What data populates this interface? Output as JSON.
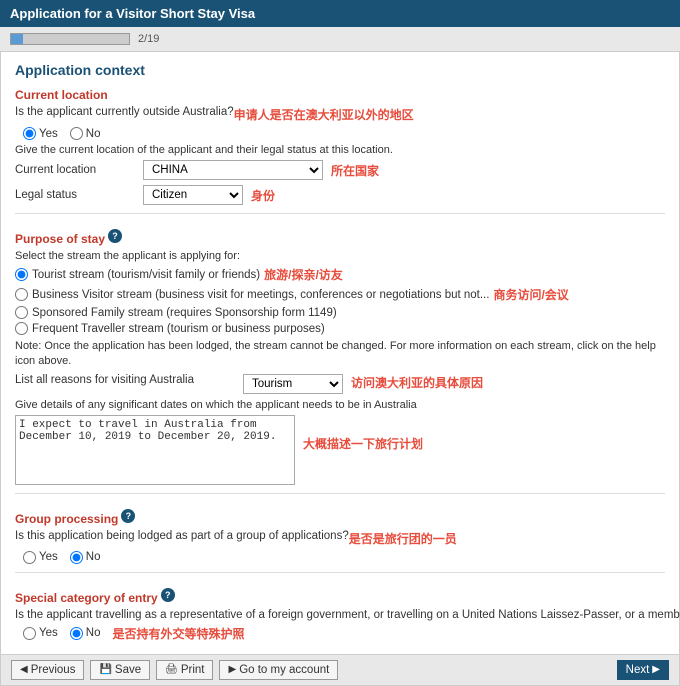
{
  "title_bar": {
    "label": "Application for a Visitor Short Stay Visa"
  },
  "progress": {
    "page_current": 2,
    "page_total": 19,
    "counter": "2/19",
    "bar_percent": 10
  },
  "application_context": {
    "section_title": "Application context",
    "current_location": {
      "subsection": "Current location",
      "question": "Is the applicant currently outside Australia?",
      "annotation": "申请人是否在澳大利亚以外的地区",
      "yes_label": "Yes",
      "no_label": "No",
      "yes_selected": true,
      "description": "Give the current location of the applicant and their legal status at this location.",
      "fields": [
        {
          "label": "Current location",
          "value": "CHINA",
          "annotation": "所在国家",
          "type": "select"
        },
        {
          "label": "Legal status",
          "value": "Citizen",
          "annotation": "身份",
          "type": "select"
        }
      ]
    },
    "purpose_of_stay": {
      "subsection": "Purpose of stay",
      "has_info": true,
      "description": "Select the stream the applicant is applying for:",
      "streams": [
        {
          "id": "tourist",
          "label": "Tourist stream (tourism/visit family or friends)",
          "selected": true,
          "annotation": "旅游/探亲/访友"
        },
        {
          "id": "business",
          "label": "Business Visitor stream (business visit for meetings, conferences or negotiations but not...",
          "selected": false,
          "annotation": "商务访问/会议"
        },
        {
          "id": "sponsored",
          "label": "Sponsored Family stream (requires Sponsorship form 1149)",
          "selected": false,
          "annotation": ""
        },
        {
          "id": "frequent",
          "label": "Frequent Traveller stream (tourism or business purposes)",
          "selected": false,
          "annotation": ""
        }
      ],
      "note": "Note: Once the application has been lodged, the stream cannot be changed. For more information on each stream, click on the help icon above.",
      "list_all_reasons_label": "List all reasons for visiting Australia",
      "list_value": "Tourism",
      "list_annotation": "访问澳大利亚的具体原因",
      "give_details_label": "Give details of any significant dates on which the applicant needs to be in Australia",
      "textarea_value": "I expect to travel in Australia from December 10, 2019 to December 20, 2019.",
      "textarea_annotation": "大概描述一下旅行计划"
    },
    "group_processing": {
      "subsection": "Group processing",
      "has_info": true,
      "question": "Is this application being lodged as part of a group of applications?",
      "annotation": "是否是旅行团的一员",
      "yes_label": "Yes",
      "no_label": "No",
      "no_selected": true
    },
    "special_category": {
      "subsection": "Special category of entry",
      "has_info": true,
      "question": "Is the applicant travelling as a representative of a foreign government, or travelling on a United Nations Laissez-Passer, or a member of an exempt group?",
      "annotation": "是否持有外交等特殊护照",
      "yes_label": "Yes",
      "no_label": "No",
      "no_selected": true
    }
  },
  "bottom_bar": {
    "previous_label": "Previous",
    "save_label": "Save",
    "print_label": "Print",
    "go_to_my_account_label": "Go to my account",
    "next_label": "Next"
  }
}
